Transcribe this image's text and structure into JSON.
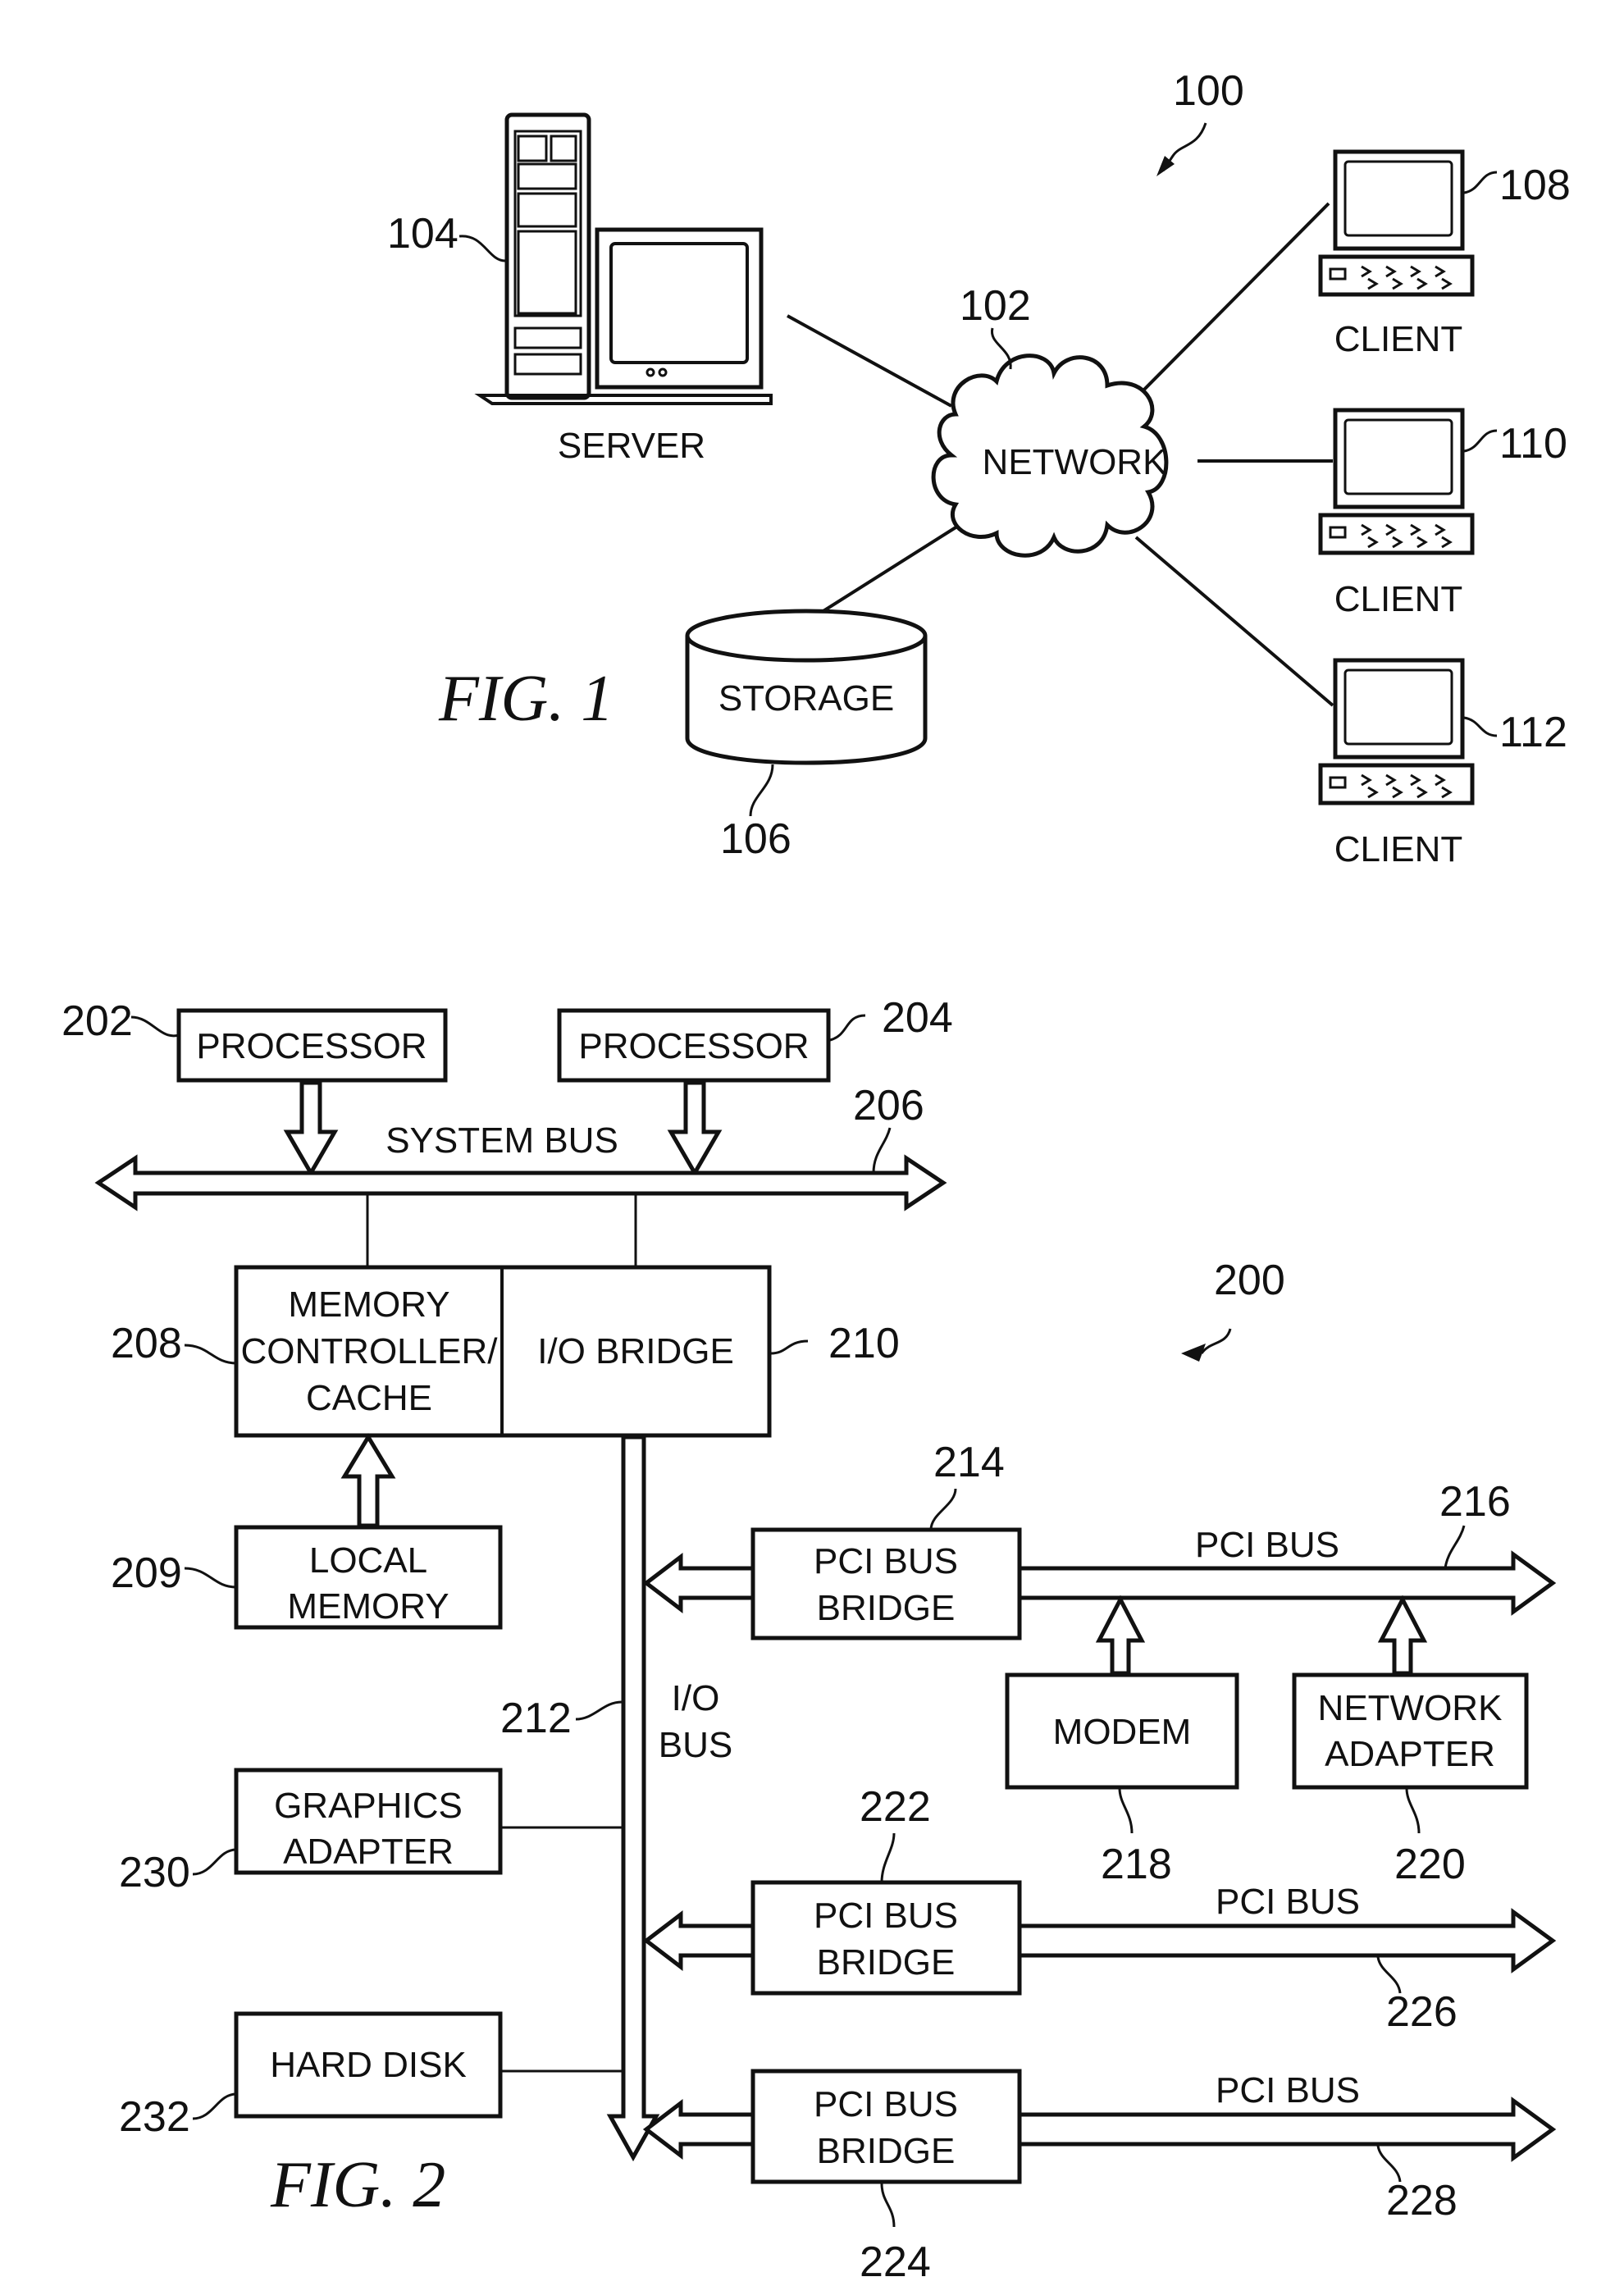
{
  "fig1": {
    "caption": "FIG. 1",
    "system_ref": "100",
    "network": {
      "label": "NETWORK",
      "ref": "102"
    },
    "server": {
      "label": "SERVER",
      "ref": "104"
    },
    "storage": {
      "label": "STORAGE",
      "ref": "106"
    },
    "clients": [
      {
        "label": "CLIENT",
        "ref": "108"
      },
      {
        "label": "CLIENT",
        "ref": "110"
      },
      {
        "label": "CLIENT",
        "ref": "112"
      }
    ]
  },
  "fig2": {
    "caption": "FIG. 2",
    "system_ref": "200",
    "processors": [
      {
        "label": "PROCESSOR",
        "ref": "202"
      },
      {
        "label": "PROCESSOR",
        "ref": "204"
      }
    ],
    "system_bus": {
      "label": "SYSTEM BUS",
      "ref": "206"
    },
    "memory_controller": {
      "lines": [
        "MEMORY",
        "CONTROLLER/",
        "CACHE"
      ],
      "ref": "208"
    },
    "local_memory": {
      "lines": [
        "LOCAL",
        "MEMORY"
      ],
      "ref": "209"
    },
    "io_bridge": {
      "label": "I/O BRIDGE",
      "ref": "210"
    },
    "io_bus": {
      "lines": [
        "I/O",
        "BUS"
      ],
      "ref": "212"
    },
    "pci_bridges": [
      {
        "lines": [
          "PCI BUS",
          "BRIDGE"
        ],
        "ref": "214",
        "bus_label": "PCI BUS",
        "bus_ref": "216"
      },
      {
        "lines": [
          "PCI BUS",
          "BRIDGE"
        ],
        "ref": "222",
        "bus_label": "PCI BUS",
        "bus_ref": "226"
      },
      {
        "lines": [
          "PCI BUS",
          "BRIDGE"
        ],
        "ref": "224",
        "bus_label": "PCI BUS",
        "bus_ref": "228"
      }
    ],
    "modem": {
      "label": "MODEM",
      "ref": "218"
    },
    "network_adapter": {
      "lines": [
        "NETWORK",
        "ADAPTER"
      ],
      "ref": "220"
    },
    "graphics_adapter": {
      "lines": [
        "GRAPHICS",
        "ADAPTER"
      ],
      "ref": "230"
    },
    "hard_disk": {
      "label": "HARD DISK",
      "ref": "232"
    }
  }
}
